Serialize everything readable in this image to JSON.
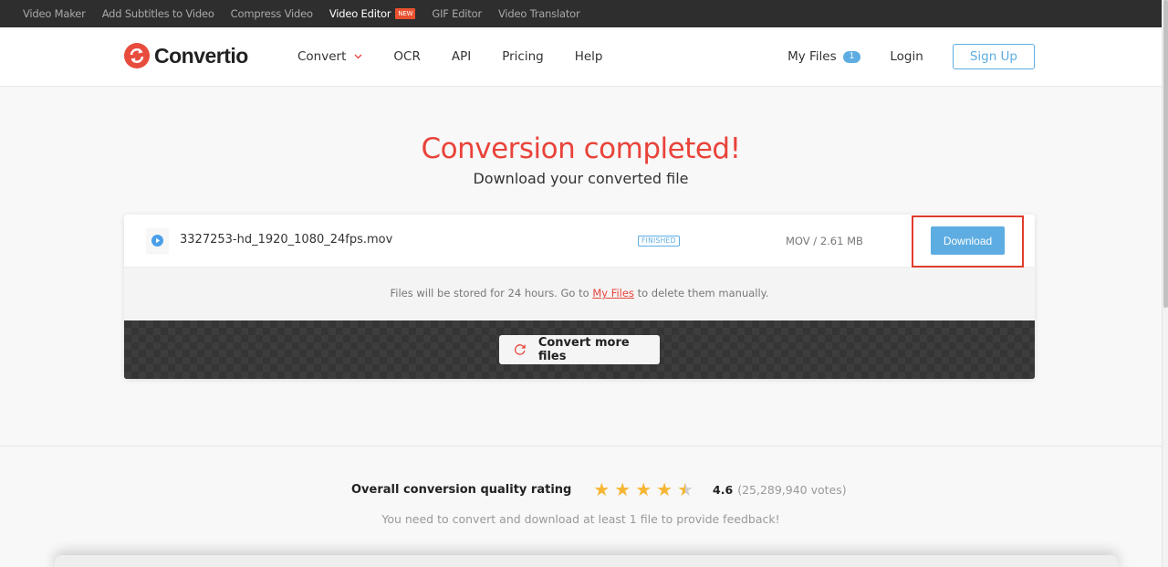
{
  "topbar": {
    "items": [
      {
        "label": "Video Maker"
      },
      {
        "label": "Add Subtitles to Video"
      },
      {
        "label": "Compress Video"
      },
      {
        "label": "Video Editor",
        "badge": "NEW",
        "active": true
      },
      {
        "label": "GIF Editor"
      },
      {
        "label": "Video Translator"
      }
    ]
  },
  "header": {
    "logo_text": "Convertio",
    "nav": [
      {
        "label": "Convert",
        "icon": "chevron-down-icon"
      },
      {
        "label": "OCR"
      },
      {
        "label": "API"
      },
      {
        "label": "Pricing"
      },
      {
        "label": "Help"
      }
    ],
    "my_files_label": "My Files",
    "my_files_count": "1",
    "login_label": "Login",
    "signup_label": "Sign Up"
  },
  "hero": {
    "title": "Conversion completed!",
    "subtitle": "Download your converted file"
  },
  "file": {
    "name": "3327253-hd_1920_1080_24fps.mov",
    "status": "FINISHED",
    "meta": "MOV / 2.61 MB",
    "download_label": "Download"
  },
  "note": {
    "prefix": "Files will be stored for 24 hours. Go to ",
    "link": "My Files",
    "suffix": " to delete them manually."
  },
  "convert_more_label": "Convert more files",
  "rating": {
    "label": "Overall conversion quality rating",
    "score": "4.6",
    "votes": "(25,289,940 votes)",
    "stars_value": 4.6,
    "stars_max": 5,
    "feedback": "You need to convert and download at least 1 file to provide feedback!"
  },
  "colors": {
    "brand_red": "#e9433a",
    "accent_blue": "#5dade2",
    "star": "#f5b634",
    "highlight_box": "#e13b2c"
  }
}
